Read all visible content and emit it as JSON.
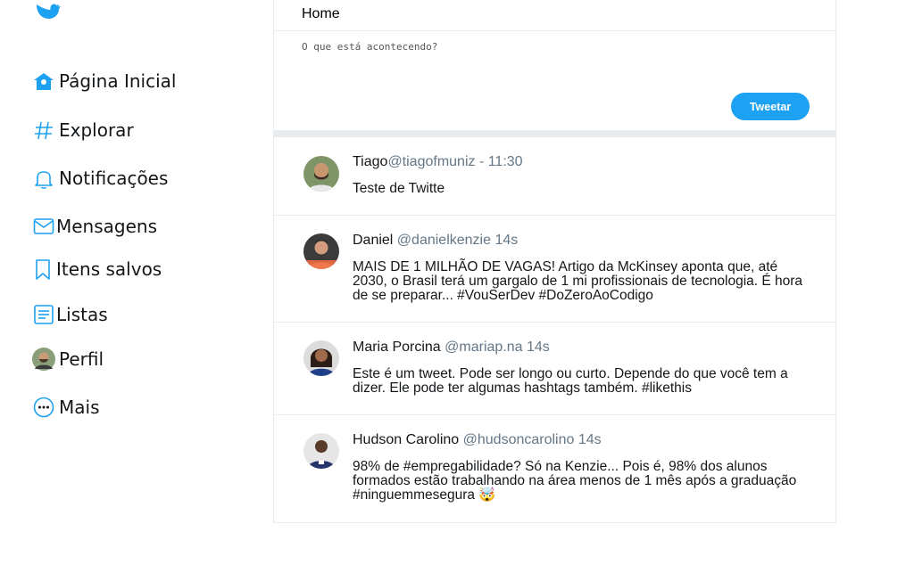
{
  "sidebar": {
    "items": [
      {
        "label": "Página Inicial",
        "icon": "home-icon"
      },
      {
        "label": "Explorar",
        "icon": "hashtag-icon"
      },
      {
        "label": "Notificações",
        "icon": "bell-icon"
      },
      {
        "label": "Mensagens",
        "icon": "envelope-icon"
      },
      {
        "label": "Itens salvos",
        "icon": "bookmark-icon"
      },
      {
        "label": "Listas",
        "icon": "list-icon"
      },
      {
        "label": "Perfil",
        "icon": "avatar"
      },
      {
        "label": "Mais",
        "icon": "more-icon"
      }
    ]
  },
  "header": {
    "title": "Home"
  },
  "composer": {
    "placeholder": "O que está acontecendo?",
    "button_label": "Tweetar"
  },
  "feed": [
    {
      "name": "Tiago",
      "handle": "@tiagofmuniz",
      "time": " - 11:30",
      "text": "Teste de Twitte"
    },
    {
      "name": "Daniel",
      "handle": " @danielkenzie",
      "time": " 14s",
      "text": "MAIS DE 1 MILHÃO DE VAGAS! Artigo da McKinsey aponta que, até 2030, o Brasil terá um gargalo de 1 mi profissionais de tecnologia. É hora de se preparar... #VouSerDev #DoZeroAoCodigo"
    },
    {
      "name": "Maria Porcina",
      "handle": " @mariap.na",
      "time": " 14s",
      "text": "Este é um tweet. Pode ser longo ou curto. Depende do que você tem a dizer. Ele pode ter algumas hashtags também. #likethis"
    },
    {
      "name": "Hudson Carolino",
      "handle": " @hudsoncarolino",
      "time": " 14s",
      "text": "98% de #empregabilidade? Só na Kenzie... Pois é, 98% dos alunos formados estão trabalhando na área menos de 1 mês após a graduação #ninguemmesegura 🤯"
    }
  ],
  "colors": {
    "accent": "#1da1f2",
    "divider": "#e6ecf0",
    "muted": "#657786"
  }
}
